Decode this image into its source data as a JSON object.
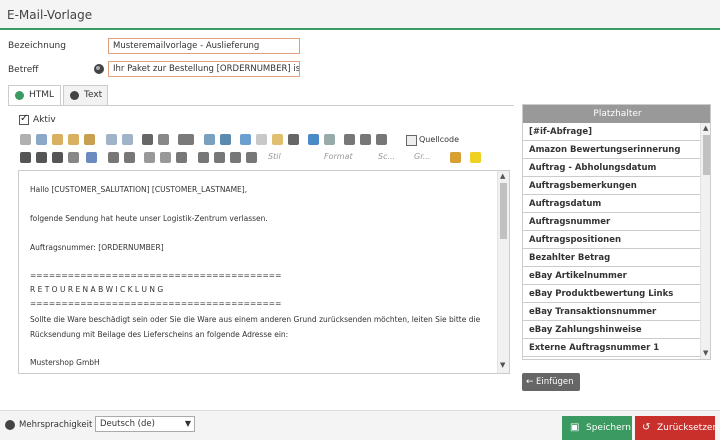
{
  "window": {
    "title": "E-Mail-Vorlage"
  },
  "form": {
    "bezeichnung_label": "Bezeichnung",
    "bezeichnung_value": "Musteremailvorlage - Auslieferung",
    "betreff_label": "Betreff",
    "betreff_value": "Ihr Paket zur Bestellung [ORDERNUMBER] ist u"
  },
  "tabs": [
    {
      "label": "HTML",
      "active": true
    },
    {
      "label": "Text",
      "active": false
    }
  ],
  "aktiv": {
    "label": "Aktiv",
    "checked": true
  },
  "toolbar": {
    "source_label": "Quellcode",
    "style_placeholder": "Stil",
    "format_placeholder": "Format",
    "font_placeholder": "Sc...",
    "size_placeholder": "Gr..."
  },
  "editor": {
    "lines": [
      "Hallo [CUSTOMER_SALUTATION] [CUSTOMER_LASTNAME],",
      "folgende Sendung hat heute unser Logistik-Zentrum verlassen.",
      "Auftragsnummer: [ORDERNUMBER]",
      "========================================",
      "R E T O U R E N A B W I C K L U N G",
      "========================================",
      "Sollte die Ware beschädigt sein oder Sie die Ware aus einem anderen Grund zurücksenden möchten, leiten Sie bitte die",
      "Rücksendung mit Beilage des Lieferscheins an folgende Adresse ein:",
      "Mustershop GmbH"
    ]
  },
  "placeholders": {
    "header": "Platzhalter",
    "items": [
      "[#if-Abfrage]",
      "Amazon Bewertungserinnerung",
      "Auftrag - Abholungsdatum",
      "Auftragsbemerkungen",
      "Auftragsdatum",
      "Auftragsnummer",
      "Auftragspositionen",
      "Bezahlter Betrag",
      "eBay Artikelnummer",
      "eBay Produktbewertung Links",
      "eBay Transaktionsnummer",
      "eBay Zahlungshinweise",
      "Externe Auftragsnummer 1"
    ],
    "insert_label": "Einfügen"
  },
  "footer": {
    "multilang_label": "Mehrsprachigkeit",
    "language_value": "Deutsch (de)",
    "save_label": "Speichern",
    "reset_label": "Zurücksetzen"
  },
  "colors": {
    "accent_green": "#3b9a61",
    "danger_red": "#c9302c",
    "input_border": "#e0a080"
  }
}
